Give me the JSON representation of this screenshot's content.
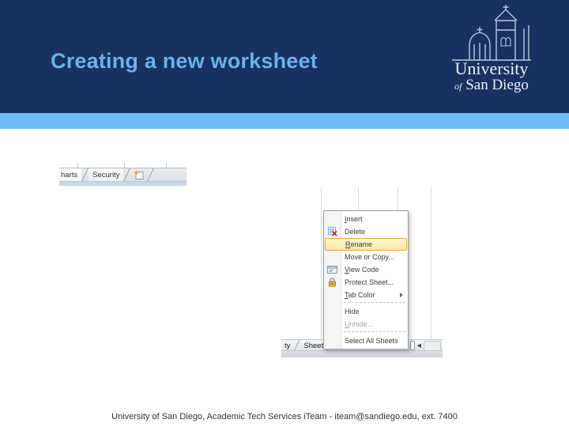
{
  "slide": {
    "title": "Creating a new worksheet",
    "footer": "University of San Diego, Academic Tech Services iTeam - iteam@sandiego.edu, ext. 7400"
  },
  "colors": {
    "header_bg": "#18315F",
    "accent_stripe": "#6FBCFC",
    "title_text": "#6CB0EC",
    "menu_highlight_fill": "#FFE8A0",
    "menu_highlight_border": "#F2A43A"
  },
  "logo": {
    "line1": "University",
    "line2_of": "of",
    "line2_rest": "San Diego",
    "icon": "mission-tower-icon"
  },
  "sheet_tabs_screenshot": {
    "partial_tab_label": "harts",
    "security_tab_label": "Security",
    "insert_icon": "insert-worksheet-icon"
  },
  "menu_screenshot": {
    "bottom_bar": {
      "partial_left_label": "ty",
      "partial_tab_label": "Sheet",
      "left_arrow": "◀"
    },
    "context_menu": {
      "items": [
        {
          "label": "Insert",
          "key": "I",
          "rest": "nsert"
        },
        {
          "label": "Delete",
          "key": "D",
          "rest": "elete",
          "icon": "delete-sheet-icon"
        },
        {
          "label": "Rename",
          "key": "R",
          "rest": "ename",
          "highlighted": true
        },
        {
          "label": "Move or Copy...",
          "key": "M",
          "rest": "ove or Copy..."
        },
        {
          "label": "View Code",
          "key": "V",
          "rest": "iew Code",
          "icon": "view-code-icon"
        },
        {
          "label": "Protect Sheet...",
          "key": "P",
          "rest": "rotect Sheet...",
          "icon": "protect-sheet-icon"
        },
        {
          "label": "Tab Color",
          "key": "T",
          "rest": "ab Color",
          "submenu": true
        },
        {
          "label": "Hide",
          "key": "H",
          "rest": "ide"
        },
        {
          "label": "Unhide...",
          "key": "U",
          "rest": "nhide...",
          "disabled": true
        },
        {
          "label": "Select All Sheets",
          "key": "S",
          "rest": "elect All Sheets"
        }
      ]
    }
  }
}
